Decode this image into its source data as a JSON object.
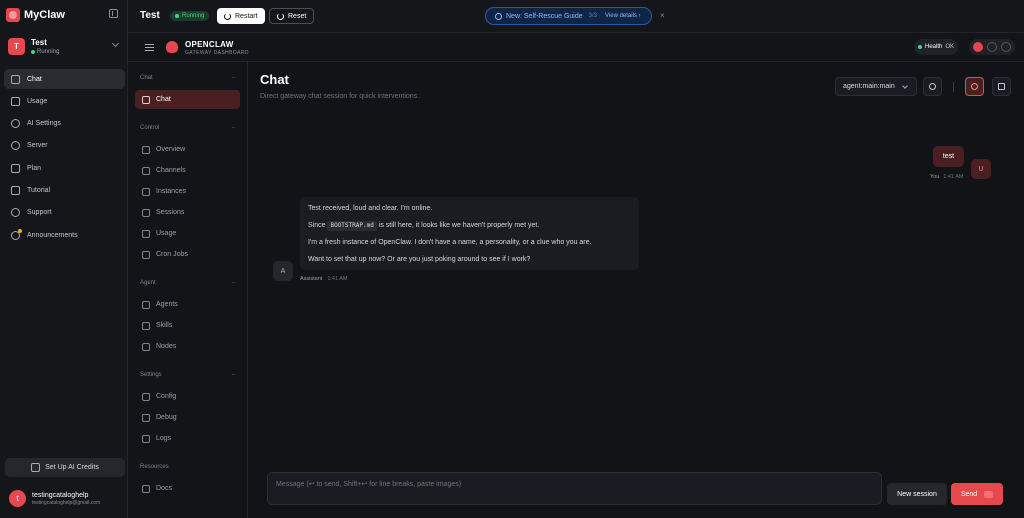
{
  "app": {
    "brand": "MyClaw",
    "workspace": {
      "initial": "T",
      "name": "Test",
      "status": "Running"
    },
    "nav": [
      {
        "label": "Chat",
        "icon": "chat-icon",
        "active": true
      },
      {
        "label": "Usage",
        "icon": "bar-chart-icon"
      },
      {
        "label": "AI Settings",
        "icon": "sparkle-icon"
      },
      {
        "label": "Server",
        "icon": "server-icon"
      },
      {
        "label": "Plan",
        "icon": "card-icon"
      },
      {
        "label": "Tutorial",
        "icon": "graduation-cap-icon"
      },
      {
        "label": "Support",
        "icon": "lifebuoy-icon"
      },
      {
        "label": "Announcements",
        "icon": "bell-icon",
        "dot": true
      }
    ],
    "credits_button": "Set Up AI Credits",
    "user": {
      "initial": "t",
      "name": "testingcataloghelp",
      "email": "testingcataloghelp@gmail.com"
    }
  },
  "topbar": {
    "title": "Test",
    "status": "Running",
    "restart": "Restart",
    "reset": "Reset",
    "banner": {
      "text": "New: Self-Rescue Guide",
      "count": "3/3",
      "details": "View details ›"
    },
    "close": "×"
  },
  "gateway": {
    "title": "OPENCLAW",
    "subtitle": "GATEWAY DASHBOARD",
    "health_label": "Health",
    "health_value": "OK"
  },
  "sub_sidebar": {
    "sections": [
      {
        "heading": "Chat",
        "items": [
          {
            "label": "Chat",
            "active": true
          }
        ]
      },
      {
        "heading": "Control",
        "items": [
          {
            "label": "Overview"
          },
          {
            "label": "Channels"
          },
          {
            "label": "Instances"
          },
          {
            "label": "Sessions"
          },
          {
            "label": "Usage"
          },
          {
            "label": "Cron Jobs"
          }
        ]
      },
      {
        "heading": "Agent",
        "items": [
          {
            "label": "Agents"
          },
          {
            "label": "Skills"
          },
          {
            "label": "Nodes"
          }
        ]
      },
      {
        "heading": "Settings",
        "items": [
          {
            "label": "Config"
          },
          {
            "label": "Debug"
          },
          {
            "label": "Logs"
          }
        ]
      },
      {
        "heading": "Resources",
        "items": [
          {
            "label": "Docs"
          }
        ]
      }
    ]
  },
  "chat": {
    "title": "Chat",
    "subtitle": "Direct gateway chat session for quick interventions.",
    "agent": "agent:main:main",
    "user_message": {
      "text": "test",
      "author": "You",
      "time": "1:41 AM",
      "initial": "U"
    },
    "assistant_message": {
      "lines": [
        "Test received, loud and clear. I'm online.",
        "is still here, it looks like we haven't properly met yet.",
        "I'm a fresh instance of OpenClaw. I don't have a name, a personality, or a clue who you are.",
        "Want to set that up now? Or are you just poking around to see if I work?"
      ],
      "since": "Since",
      "code": "BOOTSTRAP.md",
      "author": "Assistant",
      "time": "1:41 AM",
      "initial": "A"
    },
    "composer_placeholder": "Message (↩ to send, Shift+↩ for line breaks, paste images)",
    "new_session": "New session",
    "send": "Send"
  }
}
